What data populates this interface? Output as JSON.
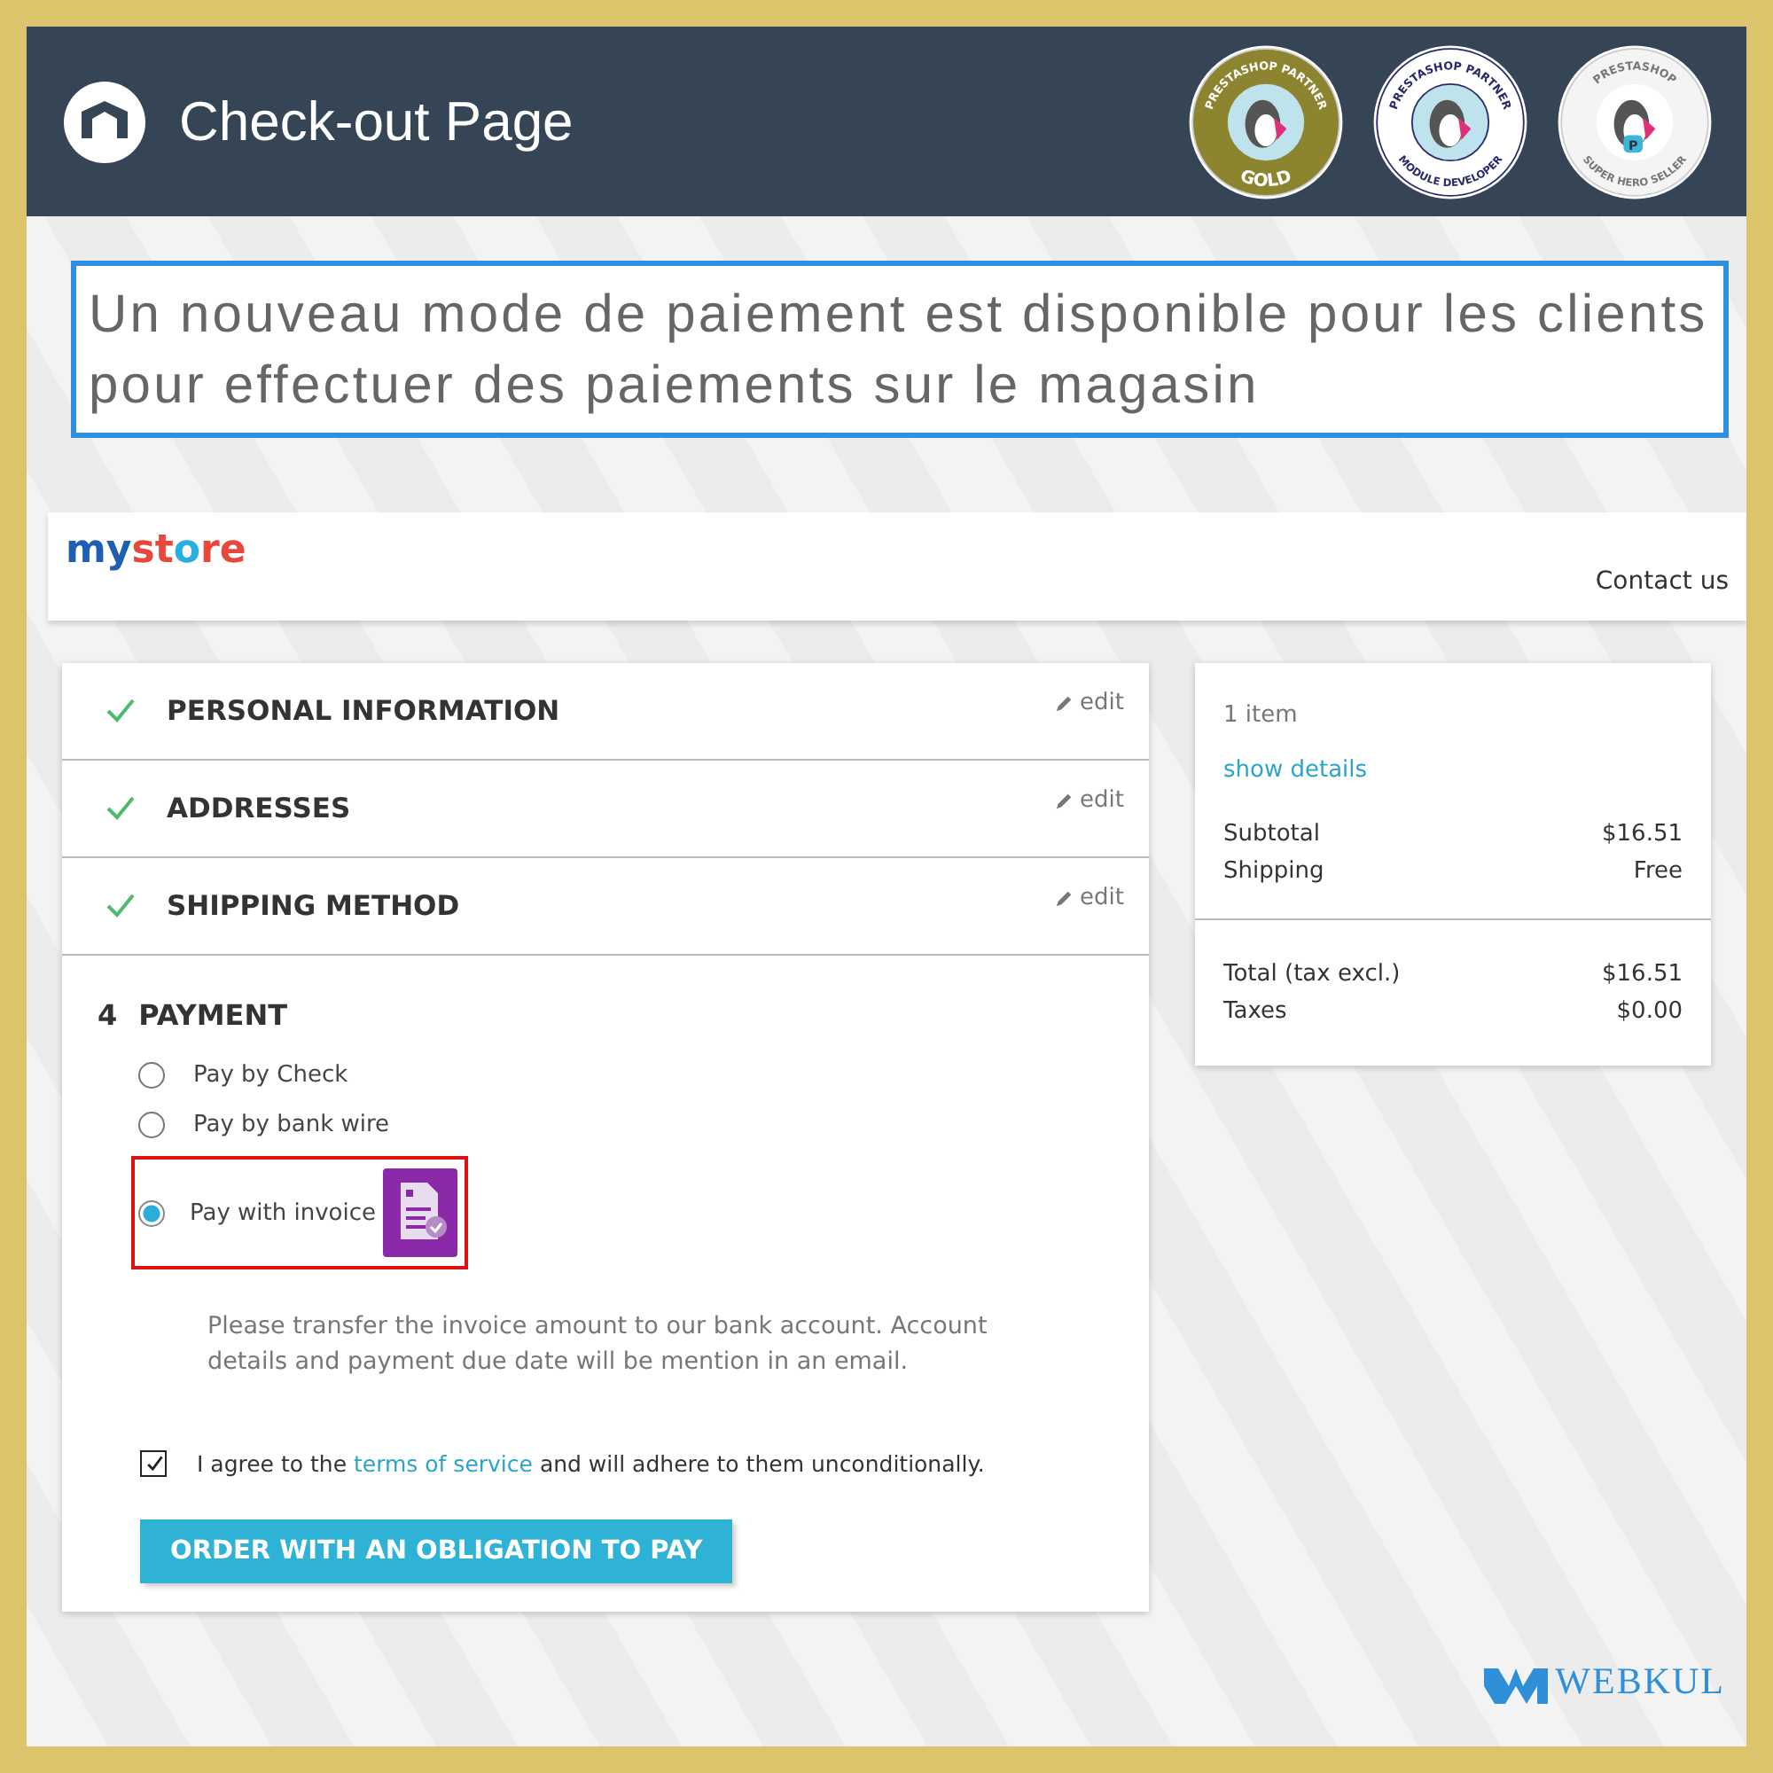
{
  "header": {
    "title": "Check-out Page",
    "badges": [
      {
        "kind": "gold",
        "top": "PRESTASHOP PARTNER",
        "bottom": "GOLD"
      },
      {
        "kind": "module",
        "top": "PRESTASHOP PARTNER",
        "bottom": "MODULE DEVELOPER"
      },
      {
        "kind": "hero",
        "top": "PRESTASHOP",
        "bottom": "SUPER HERO SELLER",
        "letter": "P"
      }
    ]
  },
  "caption": "Un nouveau mode de paiement est disponible pour les clients pour effectuer des paiements sur le magasin",
  "store": {
    "logo_parts": [
      "my",
      "st",
      "o",
      "re"
    ],
    "nav": "Contact us"
  },
  "steps": [
    {
      "label": "PERSONAL INFORMATION",
      "done": true,
      "edit": "edit"
    },
    {
      "label": "ADDRESSES",
      "done": true,
      "edit": "edit"
    },
    {
      "label": "SHIPPING METHOD",
      "done": true,
      "edit": "edit"
    }
  ],
  "payment": {
    "number": "4",
    "title": "PAYMENT",
    "options": [
      {
        "label": "Pay by Check",
        "selected": false
      },
      {
        "label": "Pay by bank wire",
        "selected": false
      },
      {
        "label": "Pay with invoice",
        "selected": true
      }
    ],
    "info": "Please transfer the invoice amount to our bank account. Account details and payment due date will be mention in an email.",
    "terms": {
      "checked": true,
      "before": "I agree to the",
      "link": "terms of service",
      "after": "and will adhere to them unconditionally."
    },
    "button": "ORDER WITH AN OBLIGATION TO PAY"
  },
  "summary": {
    "count": "1 item",
    "details_link": "show details",
    "lines": [
      {
        "label": "Subtotal",
        "value": "$16.51"
      },
      {
        "label": "Shipping",
        "value": "Free"
      }
    ],
    "totals": [
      {
        "label": "Total (tax excl.)",
        "value": "$16.51"
      },
      {
        "label": "Taxes",
        "value": "$0.00"
      }
    ]
  },
  "footer": {
    "brand": "WEBKUL"
  }
}
